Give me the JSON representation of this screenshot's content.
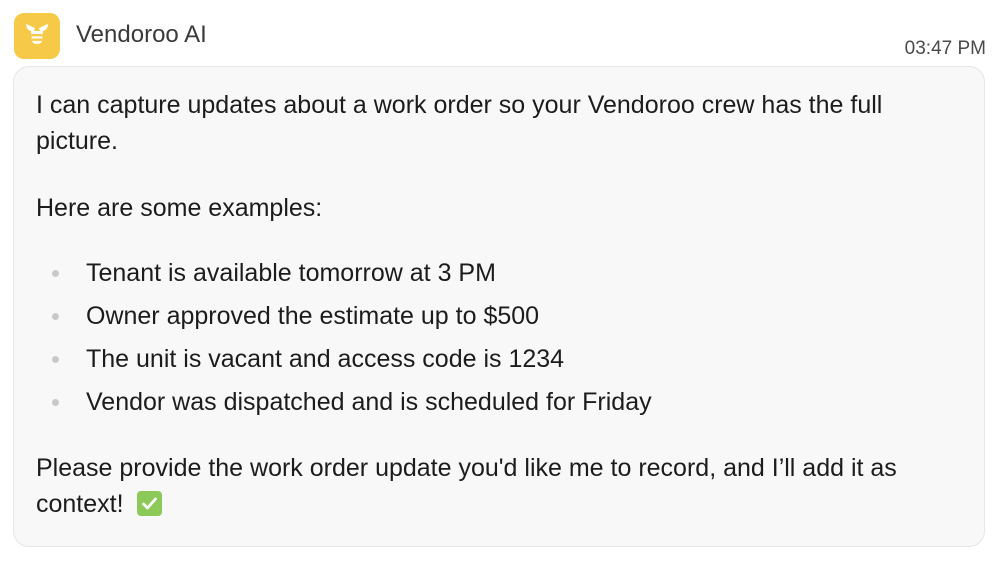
{
  "sender": {
    "name": "Vendoroo AI",
    "avatar_icon": "bee-icon",
    "avatar_color": "#f7c948"
  },
  "timestamp": "03:47 PM",
  "message": {
    "intro": "I can capture updates about a work order so your Vendoroo crew has the full picture.",
    "examples_heading": "Here are some examples:",
    "examples": [
      "Tenant is available tomorrow at 3 PM",
      "Owner approved the estimate up to $500",
      "The unit is vacant and access code is 1234",
      "Vendor was dispatched and is scheduled for Friday"
    ],
    "closing": "Please provide the work order update you'd like me to record, and I’ll add it as context!",
    "closing_icon": "check-mark-icon",
    "check_color": "#8dc958"
  }
}
